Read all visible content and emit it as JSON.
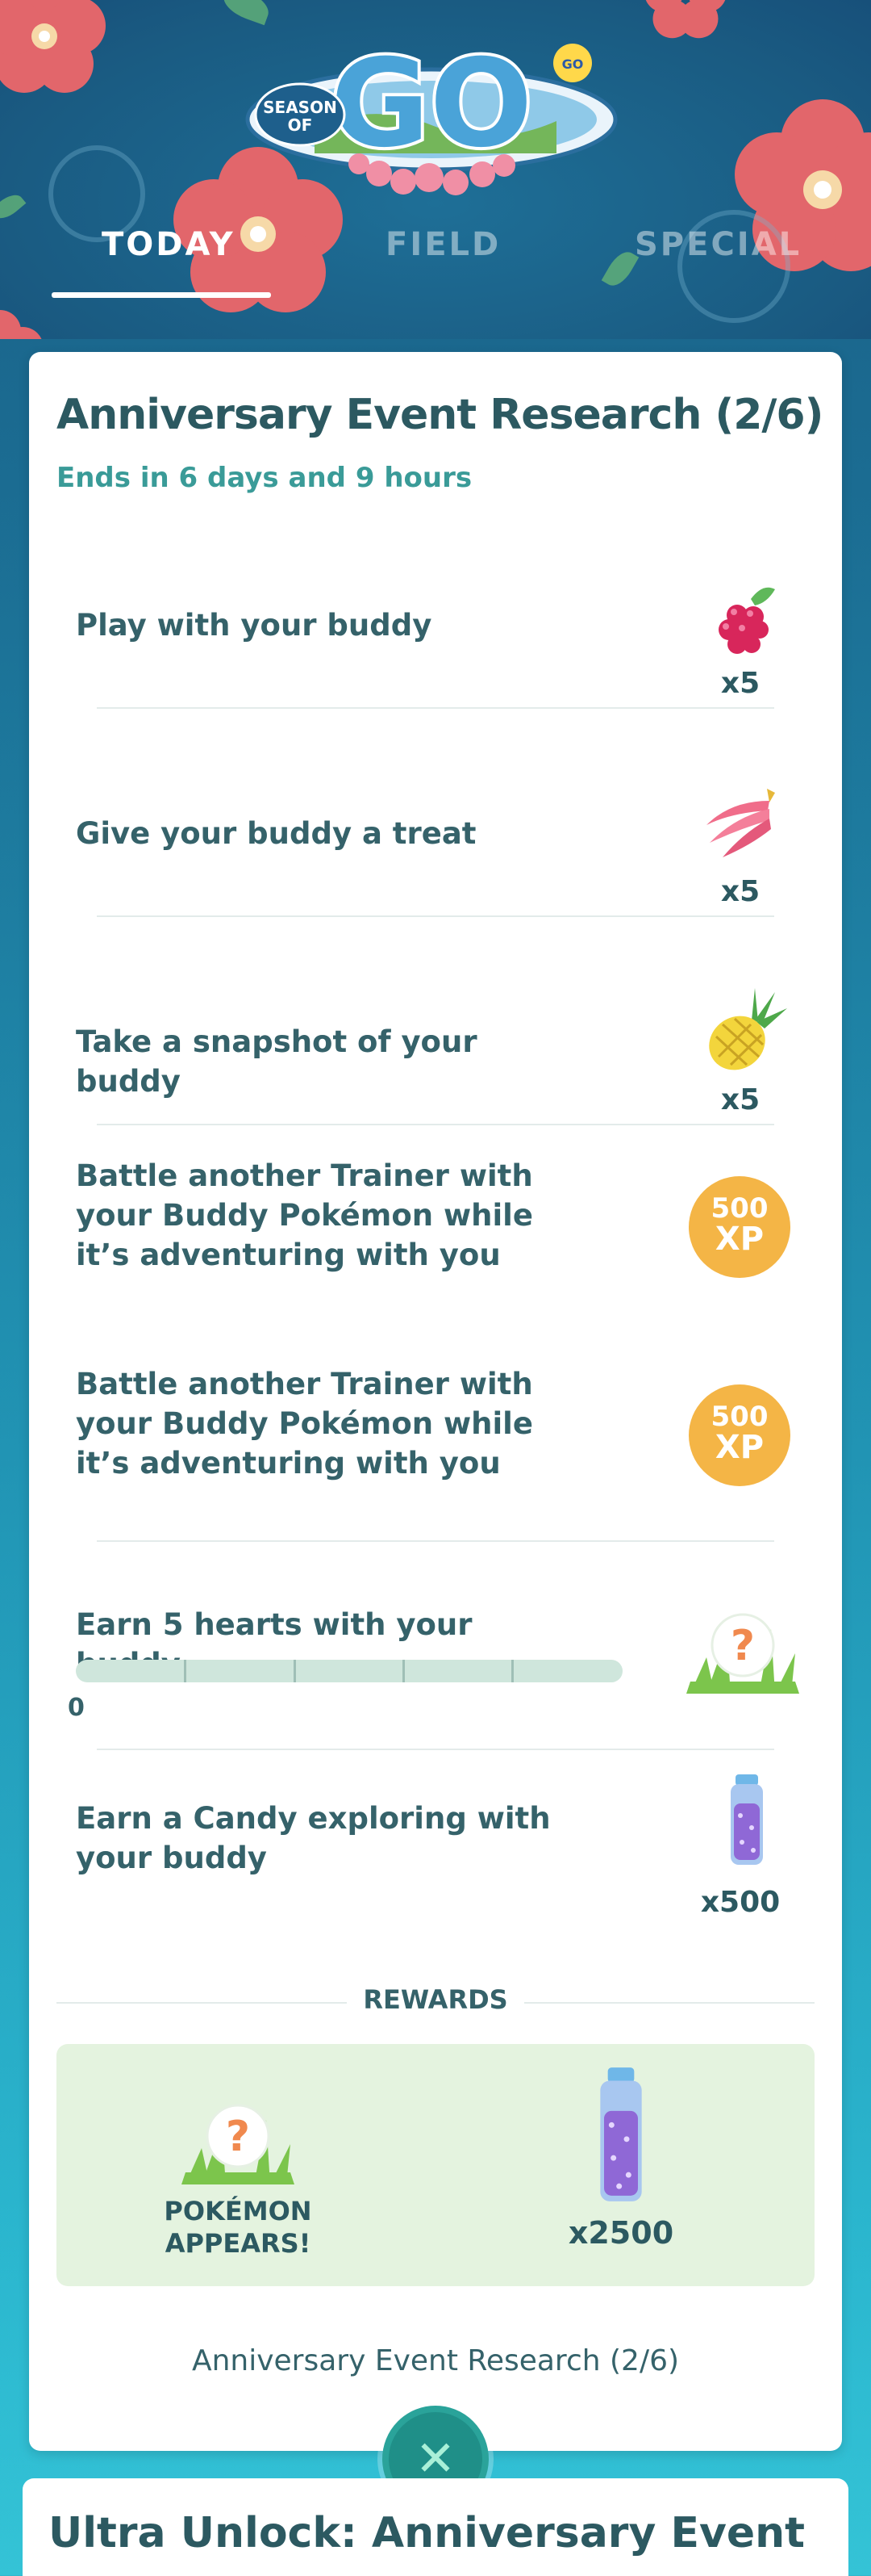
{
  "header": {
    "logo_text": "SEASON OF GO",
    "tabs": [
      {
        "label": "TODAY",
        "active": true
      },
      {
        "label": "FIELD",
        "active": false
      },
      {
        "label": "SPECIAL",
        "active": false
      }
    ]
  },
  "research": {
    "title": "Anniversary Event Research (2/6)",
    "subtitle": "Ends in 6 days and 9 hours",
    "tasks": [
      {
        "text": "Play with your buddy",
        "reward_icon": "razz-berry-icon",
        "reward_qty": "x5"
      },
      {
        "text": "Give your buddy a treat",
        "reward_icon": "nanab-berry-icon",
        "reward_qty": "x5"
      },
      {
        "text": "Take a snapshot of your buddy",
        "reward_icon": "pinap-berry-icon",
        "reward_qty": "x5"
      },
      {
        "text": "Battle another Trainer with your Buddy Pokémon while it’s adventuring with you",
        "reward_icon": "xp-icon",
        "xp_amount": "500",
        "xp_unit": "XP"
      },
      {
        "text": "Battle another Trainer with your Buddy Pokémon while it’s adventuring with you",
        "reward_icon": "xp-icon",
        "xp_amount": "500",
        "xp_unit": "XP"
      },
      {
        "text": "Earn 5 hearts with your buddy",
        "reward_icon": "mystery-pokemon-icon",
        "progress": 0,
        "progress_max": 5,
        "progress_label": "0"
      },
      {
        "text": "Earn a Candy exploring with your buddy",
        "reward_icon": "stardust-icon",
        "reward_qty": "x500"
      }
    ],
    "rewards_label": "REWARDS",
    "rewards": [
      {
        "icon": "mystery-pokemon-icon",
        "label_line1": "POKÉMON",
        "label_line2": "APPEARS!"
      },
      {
        "icon": "stardust-icon",
        "label": "x2500"
      }
    ],
    "footer_title": "Anniversary Event Research (2/6)"
  },
  "next_card": {
    "title": "Ultra Unlock: Anniversary Event"
  },
  "colors": {
    "accent": "#3a9b98",
    "text_primary": "#2c5961",
    "xp_badge": "#f4b546",
    "rewards_bg": "#e4f3df",
    "close_button": "#1f8f88"
  }
}
